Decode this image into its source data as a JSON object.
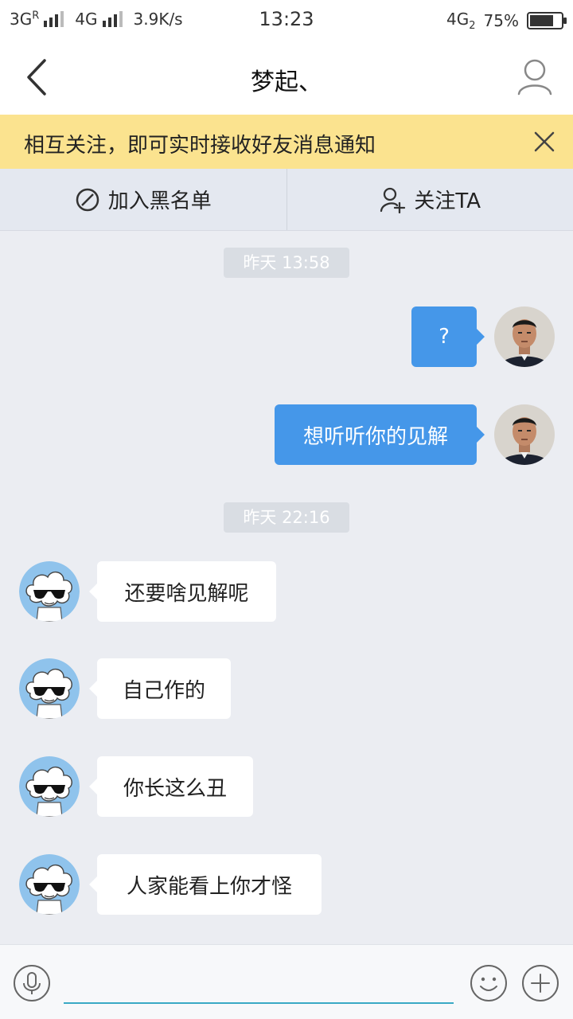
{
  "status_bar": {
    "network_1": "3G",
    "network_1_sup": "R",
    "network_2": "4G",
    "speed": "3.9K/s",
    "time": "13:23",
    "network_3": "4G",
    "network_3_sub": "2",
    "battery": "75%",
    "battery_level": 0.75
  },
  "header": {
    "title": "梦起、",
    "back_icon": "chevron-left-icon",
    "profile_icon": "person-icon"
  },
  "notice": {
    "text": "相互关注，即可实时接收好友消息通知",
    "close_icon": "close-icon"
  },
  "actions": {
    "blacklist": {
      "label": "加入黑名单",
      "icon": "block-icon"
    },
    "follow": {
      "label": "关注TA",
      "icon": "add-person-icon"
    }
  },
  "messages": {
    "time_1": "昨天 13:58",
    "out_1": "?",
    "out_2": "想听听你的见解",
    "time_2": "昨天 22:16",
    "in_1": "还要啥见解呢",
    "in_2": "自己作的",
    "in_3": "你长这么丑",
    "in_4": "人家能看上你才怪"
  },
  "input_bar": {
    "voice_icon": "microphone-icon",
    "emoji_icon": "smiley-icon",
    "plus_icon": "plus-icon",
    "value": ""
  },
  "colors": {
    "outgoing_bubble": "#4597e9",
    "notice_bg": "#fbe38f",
    "chat_bg": "#ebedf2",
    "input_underline": "#3aa9c5"
  }
}
